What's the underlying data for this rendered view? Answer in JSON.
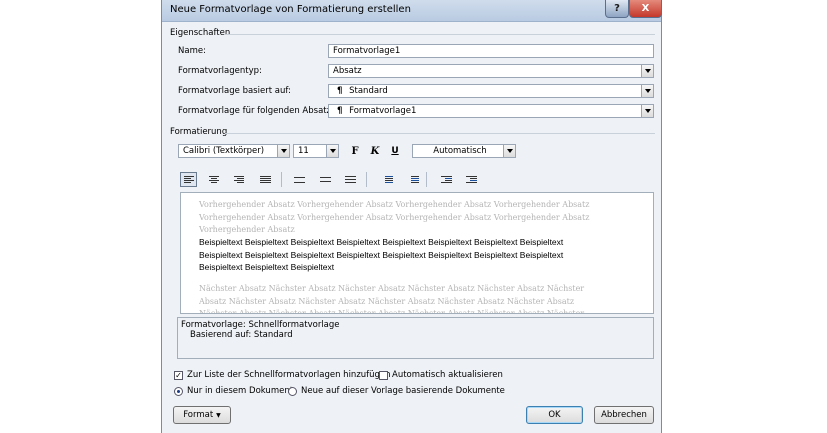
{
  "window": {
    "title": "Neue Formatvorlage von Formatierung erstellen",
    "help_label": "?",
    "close_label": "X"
  },
  "properties": {
    "heading": "Eigenschaften",
    "name_label": "Name:",
    "name_value": "Formatvorlage1",
    "type_label": "Formatvorlagentyp:",
    "type_value": "Absatz",
    "based_label": "Formatvorlage basiert auf:",
    "based_value": "Standard",
    "next_label": "Formatvorlage für folgenden Absatz:",
    "next_value": "Formatvorlage1",
    "pilcrow": "¶"
  },
  "formatting": {
    "heading": "Formatierung",
    "font": "Calibri (Textkörper)",
    "size": "11",
    "bold": "F",
    "italic": "K",
    "underline": "U",
    "color": "Automatisch"
  },
  "preview": {
    "previous": "Vorhergehender Absatz Vorhergehender Absatz Vorhergehender Absatz Vorhergehender Absatz Vorhergehender Absatz Vorhergehender Absatz Vorhergehender Absatz Vorhergehender Absatz Vorhergehender Absatz",
    "sample": "Beispieltext Beispieltext Beispieltext Beispieltext Beispieltext Beispieltext Beispieltext Beispieltext Beispieltext Beispieltext Beispieltext Beispieltext Beispieltext Beispieltext Beispieltext Beispieltext Beispieltext Beispieltext Beispieltext",
    "next": "Nächster Absatz Nächster Absatz Nächster Absatz Nächster Absatz Nächster Absatz Nächster Absatz Nächster Absatz Nächster Absatz Nächster Absatz Nächster Absatz Nächster Absatz Nächster Absatz Nächster Absatz Nächster Absatz Nächster Absatz Nächster Absatz Nächster Absatz Nächster Absatz"
  },
  "description": {
    "line1": "Formatvorlage: Schnellformatvorlage",
    "line2": "Basierend auf: Standard"
  },
  "options": {
    "add_to_list": "Zur Liste der Schnellformatvorlagen hinzufügen",
    "add_to_list_checked": true,
    "auto_update": "Automatisch aktualisieren",
    "auto_update_checked": false,
    "only_doc": "Nur in diesem Dokument",
    "new_docs": "Neue auf dieser Vorlage basierende Dokumente"
  },
  "buttons": {
    "format": "Format",
    "ok": "OK",
    "cancel": "Abbrechen"
  },
  "icons": [
    "help-icon",
    "close-icon",
    "align-left-icon",
    "align-center-icon",
    "align-right-icon",
    "justify-icon",
    "line-spacing-single-icon",
    "line-spacing-onehalf-icon",
    "line-spacing-double-icon",
    "space-before-increase-icon",
    "space-before-decrease-icon",
    "indent-decrease-icon",
    "indent-increase-icon"
  ]
}
